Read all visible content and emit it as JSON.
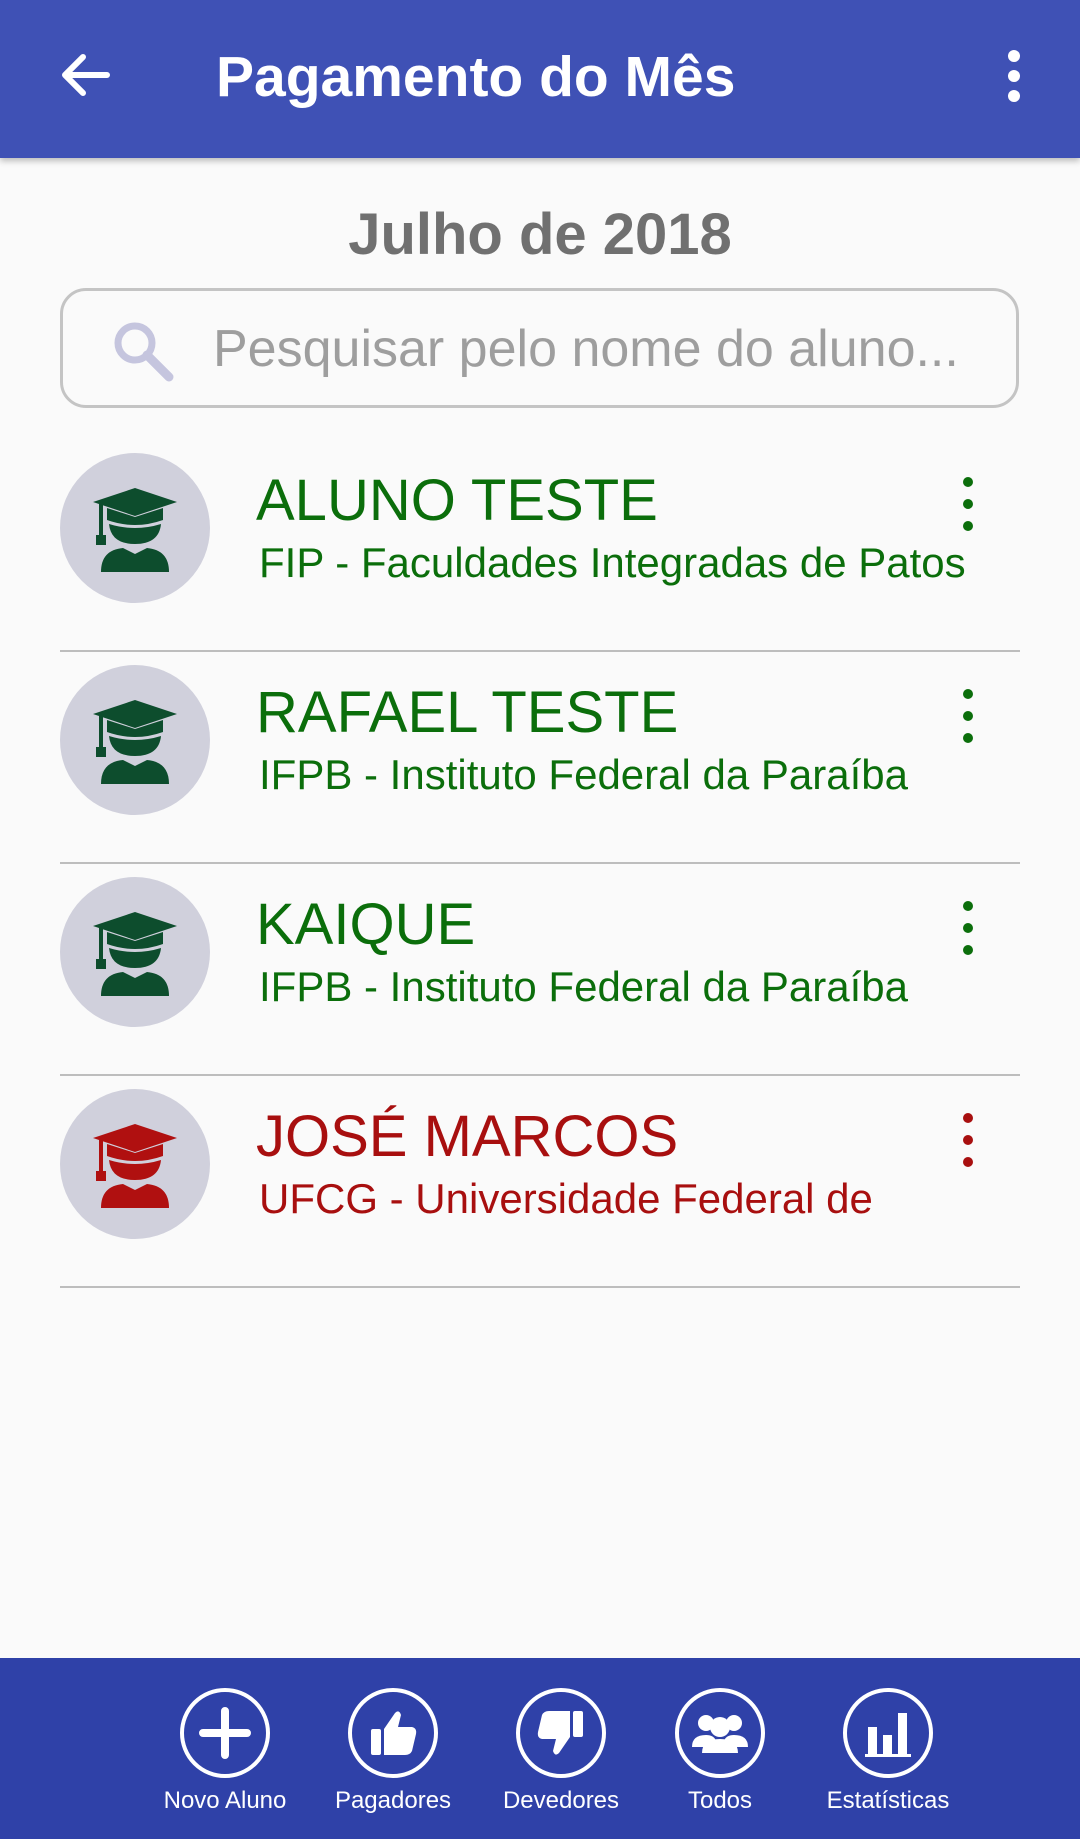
{
  "app_bar": {
    "title": "Pagamento do Mês",
    "back_icon": "arrow-left-icon",
    "menu_icon": "more-vertical-icon"
  },
  "header": {
    "month": "Julho de 2018"
  },
  "search": {
    "placeholder": "Pesquisar pelo nome do aluno...",
    "icon": "search-icon"
  },
  "students": [
    {
      "name": "ALUNO TESTE",
      "school": "FIP - Faculdades Integradas de Patos",
      "status": "pagador",
      "color": "#0b6e0b",
      "icon_color": "#0d4d2d"
    },
    {
      "name": "RAFAEL TESTE",
      "school": "IFPB - Instituto Federal da Paraíba",
      "status": "pagador",
      "color": "#0b6e0b",
      "icon_color": "#0d4d2d"
    },
    {
      "name": "KAIQUE",
      "school": "IFPB - Instituto Federal da Paraíba",
      "status": "pagador",
      "color": "#0b6e0b",
      "icon_color": "#0d4d2d"
    },
    {
      "name": "JOSÉ MARCOS",
      "school": "UFCG - Universidade Federal de",
      "status": "devedor",
      "color": "#a80f0f",
      "icon_color": "#b01010"
    }
  ],
  "bottom_nav": [
    {
      "label": "Novo Aluno",
      "icon": "plus-icon"
    },
    {
      "label": "Pagadores",
      "icon": "thumbs-up-icon"
    },
    {
      "label": "Devedores",
      "icon": "thumbs-down-icon"
    },
    {
      "label": "Todos",
      "icon": "group-icon"
    },
    {
      "label": "Estatísticas",
      "icon": "bar-chart-icon"
    }
  ],
  "colors": {
    "primary": "#3f51b5",
    "bottom_bar": "#2f41a8",
    "paid": "#0b6e0b",
    "debt": "#a80f0f"
  }
}
